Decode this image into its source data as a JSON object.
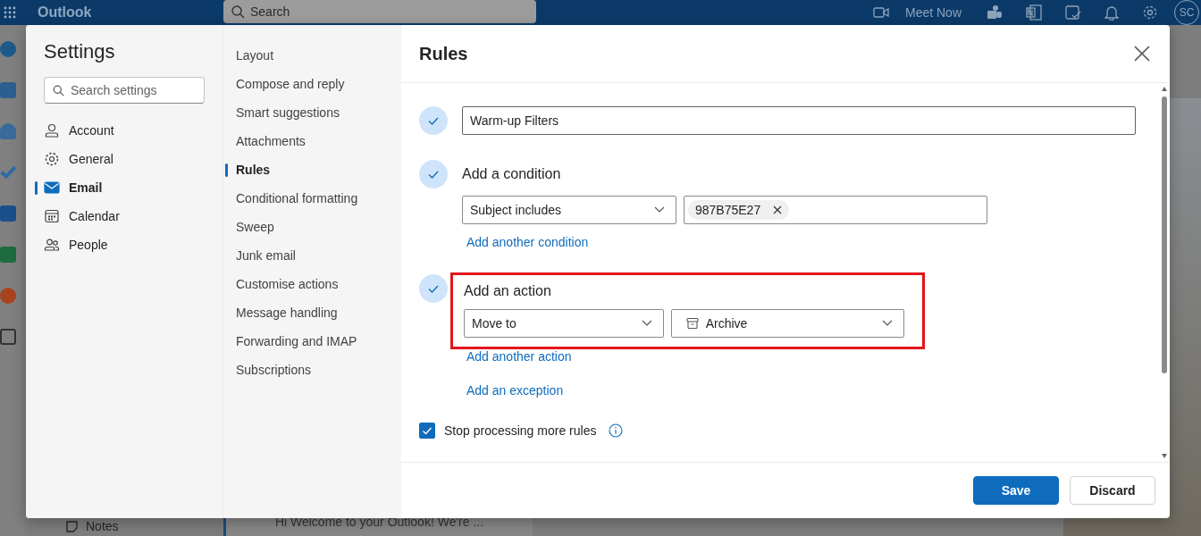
{
  "top_bar": {
    "app_name": "Outlook",
    "search": {
      "placeholder": "Search"
    },
    "meet_now": "Meet Now",
    "avatar": "SC"
  },
  "background": {
    "notes": "Notes",
    "message_preview": "Hi Welcome to your Outlook! We're ..."
  },
  "settings": {
    "title": "Settings",
    "search": {
      "placeholder": "Search settings"
    },
    "categories": [
      {
        "label": "Account",
        "selected": false
      },
      {
        "label": "General",
        "selected": false
      },
      {
        "label": "Email",
        "selected": true
      },
      {
        "label": "Calendar",
        "selected": false
      },
      {
        "label": "People",
        "selected": false
      }
    ]
  },
  "email_menu": [
    {
      "label": "Layout",
      "selected": false
    },
    {
      "label": "Compose and reply",
      "selected": false
    },
    {
      "label": "Smart suggestions",
      "selected": false
    },
    {
      "label": "Attachments",
      "selected": false
    },
    {
      "label": "Rules",
      "selected": true
    },
    {
      "label": "Conditional formatting",
      "selected": false
    },
    {
      "label": "Sweep",
      "selected": false
    },
    {
      "label": "Junk email",
      "selected": false
    },
    {
      "label": "Customise actions",
      "selected": false
    },
    {
      "label": "Message handling",
      "selected": false
    },
    {
      "label": "Forwarding and IMAP",
      "selected": false
    },
    {
      "label": "Subscriptions",
      "selected": false
    }
  ],
  "rules": {
    "title": "Rules",
    "name_step": {
      "completed": true,
      "value": "Warm-up Filters"
    },
    "condition": {
      "completed": true,
      "heading": "Add a condition",
      "field": "Subject includes",
      "chips": [
        "987B75E27"
      ],
      "add_link": "Add another condition"
    },
    "action": {
      "completed": true,
      "highlighted": true,
      "heading": "Add an action",
      "field": "Move to",
      "folder": "Archive",
      "add_link": "Add another action"
    },
    "exception_link": "Add an exception",
    "stop_processing": {
      "label": "Stop processing more rules",
      "checked": true
    },
    "buttons": [
      {
        "label": "Save",
        "primary": true
      },
      {
        "label": "Discard",
        "primary": false
      }
    ]
  }
}
